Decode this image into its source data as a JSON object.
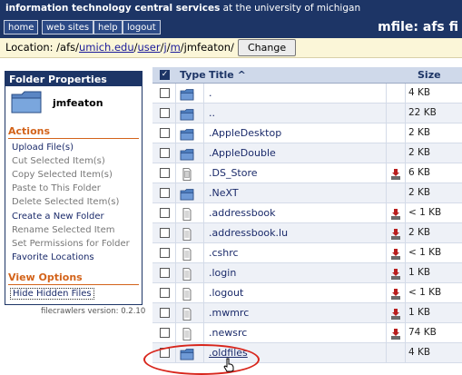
{
  "header": {
    "banner_bold": "information technology central services",
    "banner_rest": " at the university of michigan",
    "nav": [
      "home",
      "web sites",
      "help",
      "logout"
    ],
    "app_title": "mfile: afs fi"
  },
  "location": {
    "label": "Location:",
    "segments": [
      "/afs/",
      "umich.edu",
      "/",
      "user",
      "/",
      "j",
      "/",
      "m",
      "/jmfeaton/"
    ],
    "change_button": "Change"
  },
  "sidebar": {
    "title": "Folder Properties",
    "username": "jmfeaton",
    "actions_title": "Actions",
    "actions": [
      {
        "label": "Upload File(s)",
        "enabled": true
      },
      {
        "label": "Cut Selected Item(s)",
        "enabled": false
      },
      {
        "label": "Copy Selected Item(s)",
        "enabled": false
      },
      {
        "label": "Paste to This Folder",
        "enabled": false
      },
      {
        "label": "Delete Selected Item(s)",
        "enabled": false
      },
      {
        "label": "Create a New Folder",
        "enabled": true
      },
      {
        "label": "Rename Selected Item",
        "enabled": false
      },
      {
        "label": "Set Permissions for Folder",
        "enabled": false
      },
      {
        "label": "Favorite Locations",
        "enabled": true
      }
    ],
    "view_title": "View Options",
    "view_options": [
      {
        "label": "Hide Hidden Files"
      }
    ],
    "version": "filecrawlers version: 0.2.10"
  },
  "table": {
    "headers": {
      "type": "Type",
      "title": "Title ^",
      "size": "Size"
    },
    "rows": [
      {
        "type": "folder",
        "name": ".",
        "size": "4 KB",
        "download": false
      },
      {
        "type": "folder",
        "name": "..",
        "size": "22 KB",
        "download": false
      },
      {
        "type": "folder",
        "name": ".AppleDesktop",
        "size": "2 KB",
        "download": false
      },
      {
        "type": "folder",
        "name": ".AppleDouble",
        "size": "2 KB",
        "download": false
      },
      {
        "type": "file-alt",
        "name": ".DS_Store",
        "size": "6 KB",
        "download": true
      },
      {
        "type": "folder",
        "name": ".NeXT",
        "size": "2 KB",
        "download": false
      },
      {
        "type": "file",
        "name": ".addressbook",
        "size": "< 1 KB",
        "download": true
      },
      {
        "type": "file",
        "name": ".addressbook.lu",
        "size": "2 KB",
        "download": true
      },
      {
        "type": "file",
        "name": ".cshrc",
        "size": "< 1 KB",
        "download": true
      },
      {
        "type": "file",
        "name": ".login",
        "size": "1 KB",
        "download": true
      },
      {
        "type": "file",
        "name": ".logout",
        "size": "< 1 KB",
        "download": true
      },
      {
        "type": "file",
        "name": ".mwmrc",
        "size": "1 KB",
        "download": true
      },
      {
        "type": "file",
        "name": ".newsrc",
        "size": "74 KB",
        "download": true
      },
      {
        "type": "folder",
        "name": ".oldfiles",
        "size": "4 KB",
        "download": false
      }
    ]
  },
  "colors": {
    "brand_navy": "#1d3566",
    "accent_orange": "#d3631a",
    "highlight_red": "#d8261c"
  }
}
